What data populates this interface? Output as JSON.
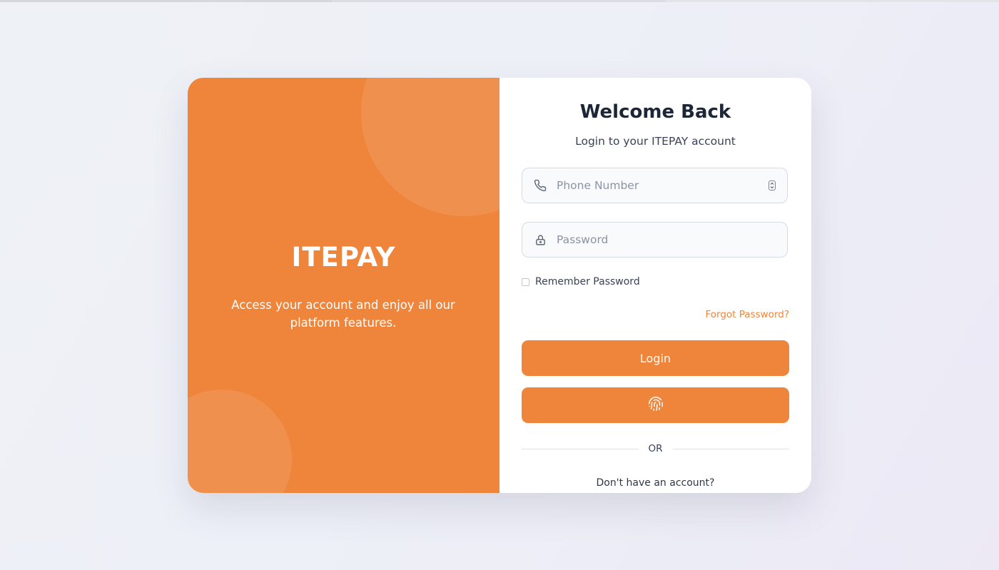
{
  "brand": {
    "name": "ITEPAY",
    "tagline": "Access your account and enjoy all our platform features."
  },
  "login": {
    "title": "Welcome Back",
    "subtitle": "Login to your ITEPAY account",
    "phone_placeholder": "Phone Number",
    "password_placeholder": "Password",
    "remember_label": "Remember Password",
    "forgot_link": "Forgot Password?",
    "login_button": "Login",
    "divider_text": "OR",
    "signup_prompt": "Don't have an account?"
  },
  "icons": {
    "phone": "phone-icon",
    "password": "lock-icon",
    "biometric": "fingerprint-icon",
    "number_spinner": "spinner-arrows-icon"
  },
  "colors": {
    "accent": "#ef843b",
    "heading": "#1d2539",
    "text": "#3a4256",
    "background": "#eef1f5"
  }
}
